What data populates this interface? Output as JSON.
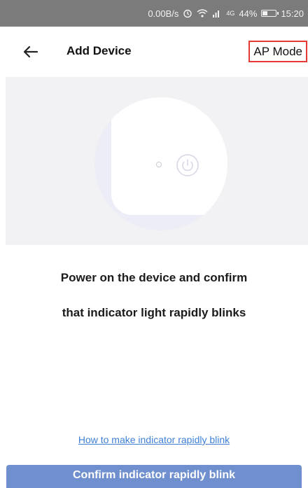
{
  "status_bar": {
    "speed": "0.00B/s",
    "alarm_icon": "alarm-icon",
    "wifi_icon": "wifi-icon",
    "signal_icon": "signal-icon",
    "sim_label": "4G",
    "battery_percent": "44%",
    "battery_level": 0.44,
    "time": "15:20"
  },
  "header": {
    "back_icon": "back-arrow-icon",
    "title": "Add Device",
    "ap_mode_label": "AP Mode",
    "ap_mode_highlight_color": "#e53935"
  },
  "illustration": {
    "device_icon": "device-illustration",
    "power_icon": "power-icon"
  },
  "instructions": {
    "line1": "Power on the device and confirm",
    "line2": "that indicator light rapidly blinks"
  },
  "help_link": "How to make indicator rapidly blink",
  "confirm_button": {
    "label": "Confirm indicator rapidly blink",
    "color": "#6f8fce"
  }
}
